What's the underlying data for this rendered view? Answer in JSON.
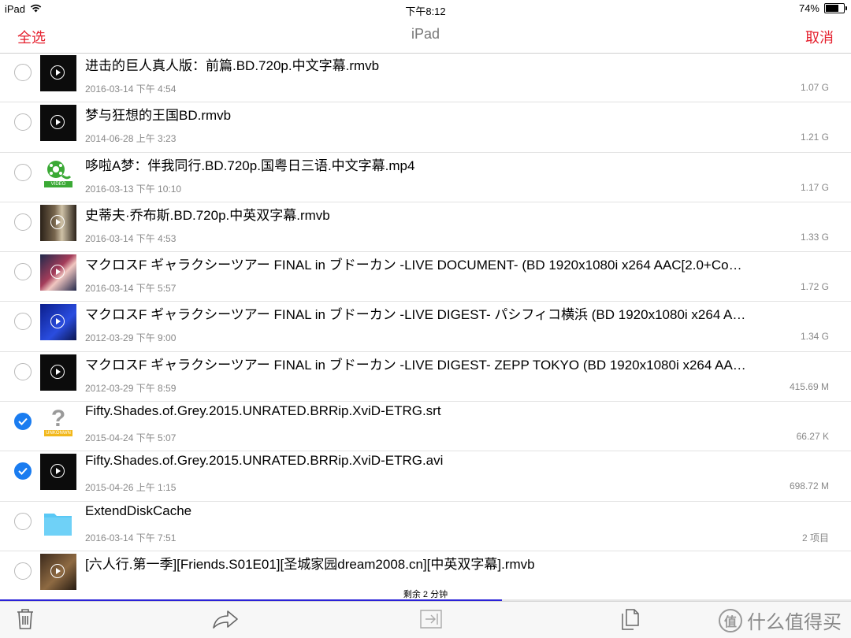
{
  "status_bar": {
    "device": "iPad",
    "time": "下午8:12",
    "battery": "74%",
    "battery_level": 0.74
  },
  "nav": {
    "select_all": "全选",
    "title": "iPad",
    "cancel": "取消"
  },
  "files": [
    {
      "name": "进击的巨人真人版：前篇.BD.720p.中文字幕.rmvb",
      "date": "2016-03-14 下午 4:54",
      "size": "1.07 G",
      "selected": false,
      "thumb": "video",
      "tone": "dark"
    },
    {
      "name": "梦与狂想的王国BD.rmvb",
      "date": "2014-06-28 上午 3:23",
      "size": "1.21 G",
      "selected": false,
      "thumb": "video",
      "tone": "dark"
    },
    {
      "name": "哆啦A梦：伴我同行.BD.720p.国粤日三语.中文字幕.mp4",
      "date": "2016-03-13 下午 10:10",
      "size": "1.17 G",
      "selected": false,
      "thumb": "video-file",
      "tone": "green",
      "badge": "VIDEO"
    },
    {
      "name": "史蒂夫·乔布斯.BD.720p.中英双字幕.rmvb",
      "date": "2016-03-14 下午 4:53",
      "size": "1.33 G",
      "selected": false,
      "thumb": "video",
      "tone": "brown"
    },
    {
      "name": "マクロスF ギャラクシーツアー FINAL in ブドーカン -LIVE DOCUMENT- (BD 1920x1080i x264 AAC[2.0+Co…",
      "date": "2016-03-14 下午 5:57",
      "size": "1.72 G",
      "selected": false,
      "thumb": "video",
      "tone": "concert"
    },
    {
      "name": "マクロスF ギャラクシーツアー FINAL in ブドーカン -LIVE DIGEST- パシフィコ横浜 (BD 1920x1080i x264 A…",
      "date": "2012-03-29 下午 9:00",
      "size": "1.34 G",
      "selected": false,
      "thumb": "video",
      "tone": "blue"
    },
    {
      "name": "マクロスF ギャラクシーツアー FINAL in ブドーカン -LIVE DIGEST- ZEPP TOKYO (BD 1920x1080i x264 AA…",
      "date": "2012-03-29 下午 8:59",
      "size": "415.69 M",
      "selected": false,
      "thumb": "video",
      "tone": "dark"
    },
    {
      "name": "Fifty.Shades.of.Grey.2015.UNRATED.BRRip.XviD-ETRG.srt",
      "date": "2015-04-24 下午 5:07",
      "size": "66.27 K",
      "selected": true,
      "thumb": "unknown",
      "tone": "unknown",
      "badge": "UNKONWN"
    },
    {
      "name": "Fifty.Shades.of.Grey.2015.UNRATED.BRRip.XviD-ETRG.avi",
      "date": "2015-04-26 上午 1:15",
      "size": "698.72 M",
      "selected": true,
      "thumb": "video",
      "tone": "dark"
    },
    {
      "name": "ExtendDiskCache",
      "date": "2016-03-14 下午 7:51",
      "size": "2 项目",
      "selected": false,
      "thumb": "folder",
      "tone": "folder"
    },
    {
      "name": "[六人行.第一季][Friends.S01E01][圣城家园dream2008.cn][中英双字幕].rmvb",
      "date": "",
      "size": "",
      "selected": false,
      "thumb": "video",
      "tone": "sitcom"
    }
  ],
  "progress": {
    "text": "剩余 2 分钟",
    "fraction": 0.59
  },
  "toolbar": {
    "icons": [
      "trash-icon",
      "share-icon",
      "move-icon",
      "copy-icon"
    ]
  },
  "watermark": {
    "logo": "值",
    "text": "什么值得买"
  },
  "colors": {
    "accent_red": "#e5202e",
    "check_blue": "#1a7cf0",
    "progress_blue": "#2b22d8",
    "folder_blue": "#5ac8f5",
    "video_green": "#3aa935"
  }
}
